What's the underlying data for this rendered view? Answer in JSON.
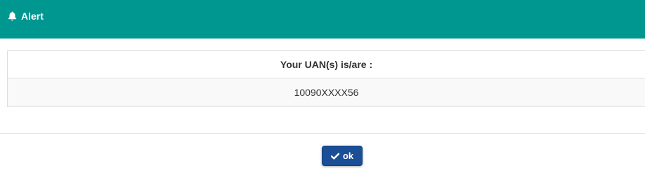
{
  "header": {
    "title": "Alert",
    "icon": "bell-icon",
    "background_color": "#009790"
  },
  "table": {
    "header_label": "Your UAN(s) is/are :",
    "rows": [
      {
        "uan": "10090XXXX56"
      }
    ]
  },
  "footer": {
    "ok_label": "ok",
    "ok_icon": "check-icon",
    "button_color": "#1a4e96"
  }
}
